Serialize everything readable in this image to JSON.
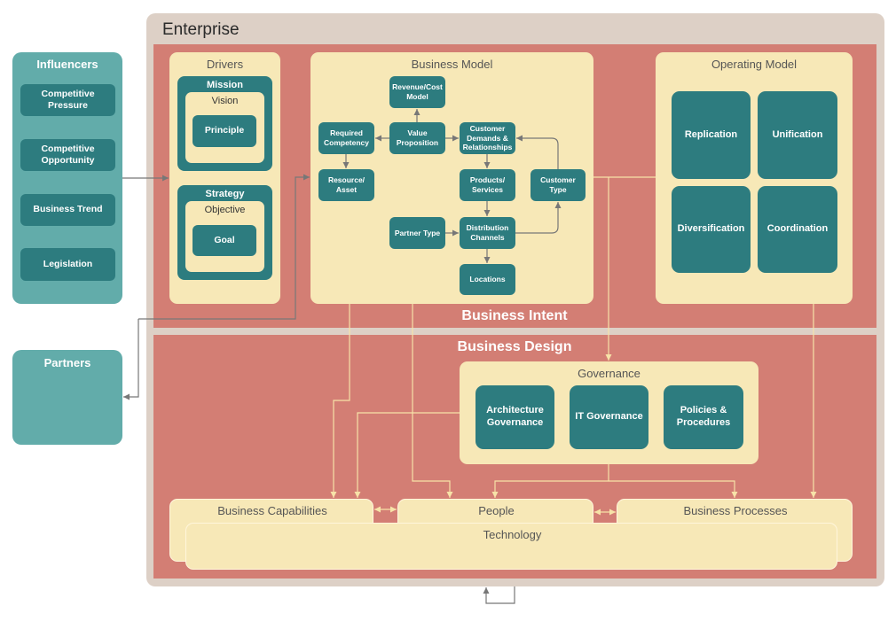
{
  "colors": {
    "frame": "#ddd0c6",
    "region": "#d37e74",
    "panel": "#f7e8b7",
    "node": "#2d7c7f",
    "external": "#62acaa",
    "connector_light": "#f7e3a8",
    "connector_dark": "#777777"
  },
  "enterprise": {
    "title": "Enterprise"
  },
  "influencers": {
    "title": "Influencers",
    "items": [
      {
        "label": "Competitive\nPressure"
      },
      {
        "label": "Competitive\nOpportunity"
      },
      {
        "label": "Business Trend"
      },
      {
        "label": "Legislation"
      }
    ]
  },
  "partners": {
    "title": "Partners"
  },
  "business_intent": {
    "label": "Business Intent",
    "drivers": {
      "title": "Drivers",
      "mission": "Mission",
      "vision": "Vision",
      "principle": "Principle",
      "strategy": "Strategy",
      "objective": "Objective",
      "goal": "Goal"
    },
    "business_model": {
      "title": "Business Model",
      "nodes": [
        {
          "id": "revenue_cost_model",
          "label": "Revenue/Cost\nModel"
        },
        {
          "id": "required_competency",
          "label": "Required\nCompetency"
        },
        {
          "id": "value_proposition",
          "label": "Value\nProposition"
        },
        {
          "id": "customer_demands",
          "label": "Customer\nDemands &\nRelationships"
        },
        {
          "id": "resource_asset",
          "label": "Resource/\nAsset"
        },
        {
          "id": "products_services",
          "label": "Products/\nServices"
        },
        {
          "id": "customer_type",
          "label": "Customer\nType"
        },
        {
          "id": "partner_type",
          "label": "Partner Type"
        },
        {
          "id": "distribution_channels",
          "label": "Distribution\nChannels"
        },
        {
          "id": "locations",
          "label": "Locations"
        }
      ]
    },
    "operating_model": {
      "title": "Operating Model",
      "quadrants": [
        {
          "label": "Replication"
        },
        {
          "label": "Unification"
        },
        {
          "label": "Diversification"
        },
        {
          "label": "Coordination"
        }
      ]
    }
  },
  "business_design": {
    "label": "Business Design",
    "governance": {
      "title": "Governance",
      "items": [
        {
          "label": "Architecture\nGovernance"
        },
        {
          "label": "IT Governance"
        },
        {
          "label": "Policies &\nProcedures"
        }
      ]
    },
    "capabilities": "Business Capabilities",
    "people": "People",
    "processes": "Business Processes",
    "technology": "Technology"
  }
}
